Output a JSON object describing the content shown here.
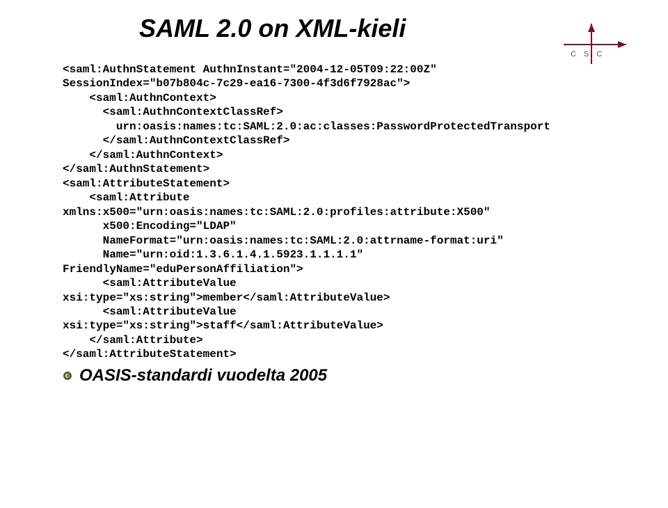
{
  "title": "SAML 2.0 on XML-kieli",
  "logo_text": "C S C",
  "code_lines": [
    "<saml:AuthnStatement AuthnInstant=\"2004-12-05T09:22:00Z\"",
    "SessionIndex=\"b07b804c-7c29-ea16-7300-4f3d6f7928ac\">",
    "    <saml:AuthnContext>",
    "      <saml:AuthnContextClassRef>",
    "        urn:oasis:names:tc:SAML:2.0:ac:classes:PasswordProtectedTransport",
    "      </saml:AuthnContextClassRef>",
    "    </saml:AuthnContext>",
    "</saml:AuthnStatement>",
    "<saml:AttributeStatement>",
    "    <saml:Attribute",
    "xmlns:x500=\"urn:oasis:names:tc:SAML:2.0:profiles:attribute:X500\"",
    "      x500:Encoding=\"LDAP\"",
    "      NameFormat=\"urn:oasis:names:tc:SAML:2.0:attrname-format:uri\"",
    "      Name=\"urn:oid:1.3.6.1.4.1.5923.1.1.1.1\"",
    "FriendlyName=\"eduPersonAffiliation\">",
    "      <saml:AttributeValue",
    "xsi:type=\"xs:string\">member</saml:AttributeValue>",
    "      <saml:AttributeValue",
    "xsi:type=\"xs:string\">staff</saml:AttributeValue>",
    "    </saml:Attribute>",
    "</saml:AttributeStatement>"
  ],
  "summary": "OASIS-standardi vuodelta 2005",
  "colors": {
    "logo_accent": "#7a0f2b",
    "bullet_outer": "#3a6e3a",
    "bullet_inner": "#d46a1a"
  }
}
